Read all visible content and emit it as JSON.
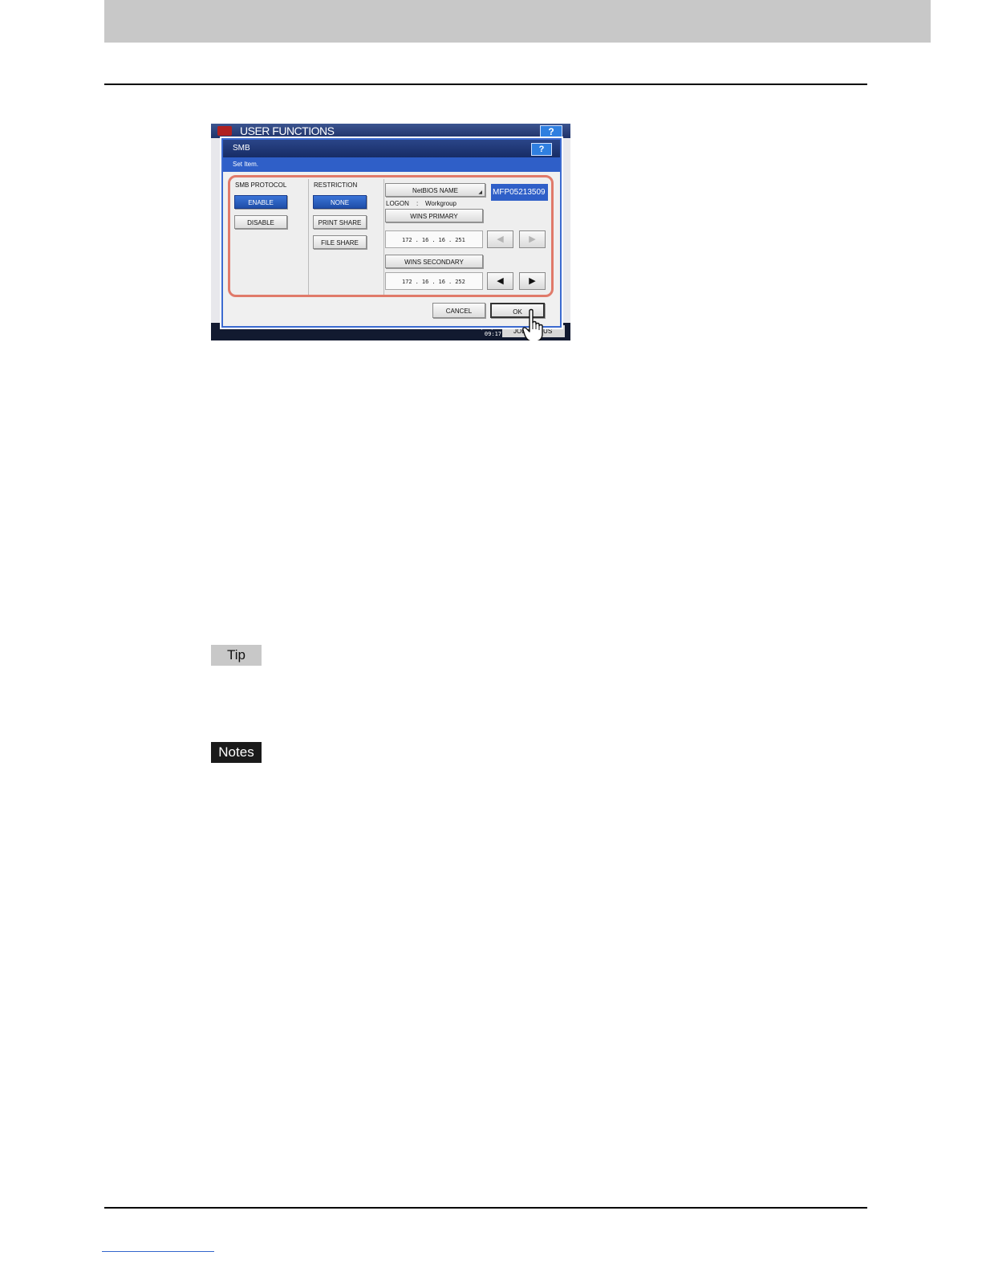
{
  "screen": {
    "app_title": "USER FUNCTIONS",
    "app_help": "?",
    "clock": "2011/03/15 09:17",
    "job_status": "JOB STATUS",
    "dialog": {
      "title": "SMB",
      "help": "?",
      "subtitle": "Set Item.",
      "smb_protocol": {
        "label": "SMB PROTOCOL",
        "enable": "ENABLE",
        "disable": "DISABLE",
        "selected": "ENABLE"
      },
      "restriction": {
        "label": "RESTRICTION",
        "none": "NONE",
        "print_share": "PRINT SHARE",
        "file_share": "FILE SHARE",
        "selected": "NONE"
      },
      "netbios": {
        "button": "NetBIOS NAME",
        "value": "MFP05213509"
      },
      "logon": {
        "label": "LOGON",
        "sep": ":",
        "value": "Workgroup"
      },
      "wins_primary": {
        "button": "WINS PRIMARY",
        "octets": [
          "172",
          "16",
          "16",
          "251"
        ]
      },
      "wins_secondary": {
        "button": "WINS SECONDARY",
        "octets": [
          "172",
          "16",
          "16",
          "252"
        ]
      },
      "nav": {
        "left": "◀",
        "right": "▶"
      },
      "cancel": "CANCEL",
      "ok": "OK"
    }
  },
  "tip_label": "Tip",
  "notes_label": "Notes",
  "colors": {
    "accent_blue": "#2f5fc8",
    "highlight_frame": "#e07a6a",
    "header_band": "#c8c8c8"
  }
}
